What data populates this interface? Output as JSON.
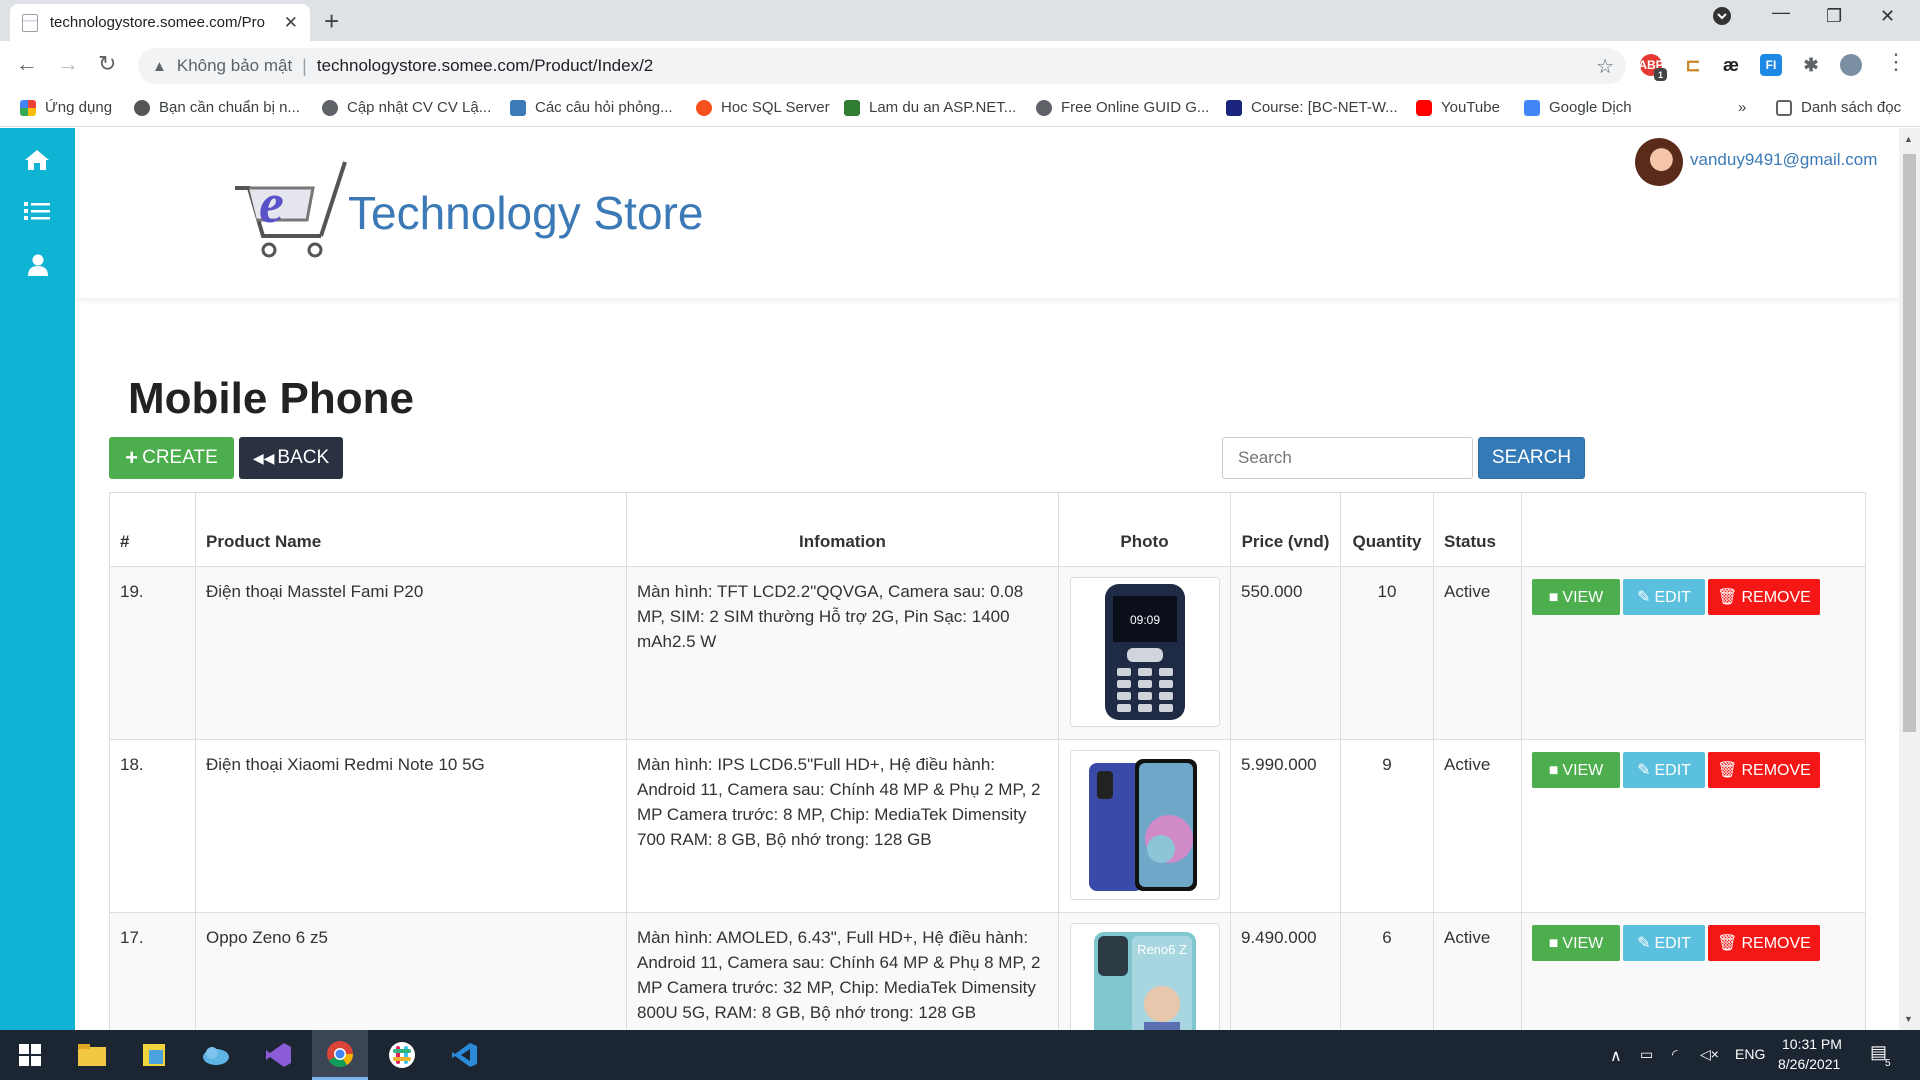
{
  "browser": {
    "tab_title": "technologystore.somee.com/Pro",
    "security_label": "Không bảo mật",
    "url": "technologystore.somee.com/Product/Index/2",
    "bookmarks": [
      "Ứng dụng",
      "Bạn cần chuẩn bị n...",
      "Cập nhật CV CV Lậ...",
      "Các câu hỏi phỏng...",
      "Hoc SQL Server",
      "Lam du an ASP.NET...",
      "Free Online GUID G...",
      "Course: [BC-NET-W...",
      "YouTube",
      "Google Dịch"
    ],
    "bookmarks_overflow": "»",
    "reading_list": "Danh sách đọc",
    "extension_badge": "1"
  },
  "site": {
    "brand": "Technology Store",
    "user_email": "vanduy9491@gmail.com"
  },
  "page": {
    "title": "Mobile Phone",
    "create_label": "CREATE",
    "back_label": "BACK",
    "search_placeholder": "Search",
    "search_label": "SEARCH"
  },
  "table": {
    "headers": {
      "num": "#",
      "name": "Product Name",
      "info": "Infomation",
      "photo": "Photo",
      "price": "Price (vnd)",
      "qty": "Quantity",
      "status": "Status"
    },
    "action_labels": {
      "view": "VIEW",
      "edit": "EDIT",
      "remove": "REMOVE"
    },
    "rows": [
      {
        "num": "19.",
        "name": "Điện thoại Masstel Fami P20",
        "info": "Màn hình: TFT LCD2.2\"QQVGA, Camera sau: 0.08 MP, SIM: 2 SIM thường Hỗ trợ 2G, Pin Sạc: 1400 mAh2.5 W",
        "price": "550.000",
        "qty": "10",
        "status": "Active",
        "screen_text": "09:09"
      },
      {
        "num": "18.",
        "name": "Điện thoại Xiaomi Redmi Note 10 5G",
        "info": "Màn hình: IPS LCD6.5\"Full HD+, Hệ điều hành: Android 11, Camera sau: Chính 48 MP & Phụ 2 MP, 2 MP Camera trước: 8 MP, Chip: MediaTek Dimensity 700 RAM: 8 GB, Bộ nhớ trong: 128 GB",
        "price": "5.990.000",
        "qty": "9",
        "status": "Active"
      },
      {
        "num": "17.",
        "name": "Oppo Zeno 6 z5",
        "info": "Màn hình: AMOLED, 6.43\", Full HD+, Hệ điều hành: Android 11, Camera sau: Chính 64 MP & Phụ 8 MP, 2 MP Camera trước: 32 MP, Chip: MediaTek Dimensity 800U 5G, RAM: 8 GB, Bộ nhớ trong: 128 GB",
        "price": "9.490.000",
        "qty": "6",
        "status": "Active",
        "screen_text": "Reno6 Z"
      }
    ]
  },
  "taskbar": {
    "language": "ENG",
    "time": "10:31 PM",
    "date": "8/26/2021",
    "notifications": "5"
  }
}
